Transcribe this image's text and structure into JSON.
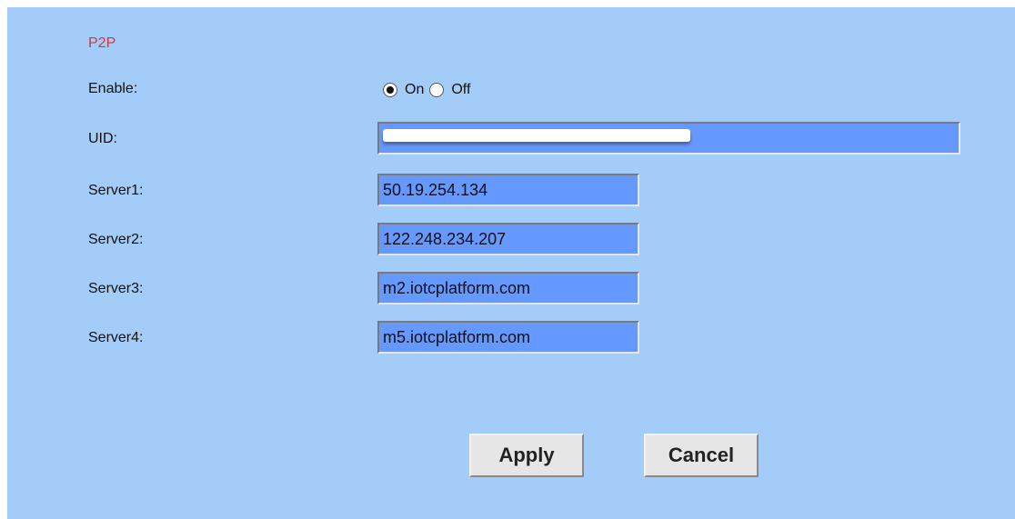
{
  "section": {
    "title": "P2P"
  },
  "enable": {
    "label": "Enable:",
    "options": [
      {
        "label": "On",
        "selected": true
      },
      {
        "label": "Off",
        "selected": false
      }
    ]
  },
  "uid": {
    "label": "UID:",
    "value": ""
  },
  "servers": [
    {
      "label": "Server1:",
      "value": "50.19.254.134"
    },
    {
      "label": "Server2:",
      "value": "122.248.234.207"
    },
    {
      "label": "Server3:",
      "value": "m2.iotcplatform.com"
    },
    {
      "label": "Server4:",
      "value": "m5.iotcplatform.com"
    }
  ],
  "buttons": {
    "apply": "Apply",
    "cancel": "Cancel"
  },
  "colors": {
    "background": "#a3cdf8",
    "field": "#6699ff",
    "section_title": "#d2383c",
    "button": "#e6e6e6"
  }
}
